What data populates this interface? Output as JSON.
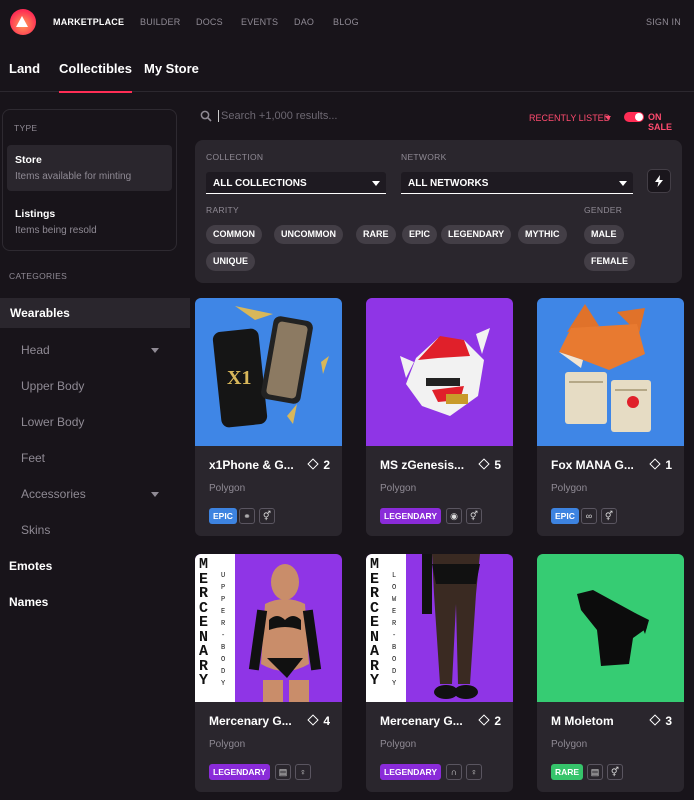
{
  "nav": {
    "items": [
      "MARKETPLACE",
      "BUILDER",
      "DOCS",
      "EVENTS",
      "DAO",
      "BLOG"
    ],
    "sign_in": "SIGN IN"
  },
  "tabs": [
    "Land",
    "Collectibles",
    "My Store"
  ],
  "sidebar": {
    "type_label": "TYPE",
    "types": [
      {
        "title": "Store",
        "subtitle": "Items available for minting"
      },
      {
        "title": "Listings",
        "subtitle": "Items being resold"
      }
    ],
    "categories_label": "CATEGORIES",
    "categories": [
      "Wearables",
      "Head",
      "Upper Body",
      "Lower Body",
      "Feet",
      "Accessories",
      "Skins",
      "Emotes",
      "Names"
    ]
  },
  "search": {
    "placeholder": "Search +1,000 results..."
  },
  "sort": {
    "label": "RECENTLY LISTED"
  },
  "on_sale": {
    "label": "ON SALE",
    "enabled": true
  },
  "filters": {
    "collection_label": "COLLECTION",
    "collection_value": "ALL COLLECTIONS",
    "network_label": "NETWORK",
    "network_value": "ALL NETWORKS",
    "rarity_label": "RARITY",
    "rarities": [
      "COMMON",
      "UNCOMMON",
      "RARE",
      "EPIC",
      "LEGENDARY",
      "MYTHIC",
      "UNIQUE"
    ],
    "gender_label": "GENDER",
    "genders": [
      "MALE",
      "FEMALE"
    ]
  },
  "cards": [
    {
      "name": "x1Phone & G...",
      "count": "2",
      "network": "Polygon",
      "rarity": "EPIC",
      "rarity_color": "#3d83e0",
      "bg": "#3f86e6"
    },
    {
      "name": "MS zGenesis...",
      "count": "5",
      "network": "Polygon",
      "rarity": "LEGENDARY",
      "rarity_color": "#8a2bd9",
      "bg": "#8f35e6"
    },
    {
      "name": "Fox MANA G...",
      "count": "1",
      "network": "Polygon",
      "rarity": "EPIC",
      "rarity_color": "#3d83e0",
      "bg": "#3f86e6"
    },
    {
      "name": "Mercenary G...",
      "count": "4",
      "network": "Polygon",
      "rarity": "LEGENDARY",
      "rarity_color": "#8a2bd9",
      "bg": "#8f35e6",
      "side_text": "MERCENARY",
      "side_sub": "UPPER-BODY"
    },
    {
      "name": "Mercenary G...",
      "count": "2",
      "network": "Polygon",
      "rarity": "LEGENDARY",
      "rarity_color": "#8a2bd9",
      "bg": "#8f35e6",
      "side_text": "MERCENARY",
      "side_sub": "LOWER-BODY"
    },
    {
      "name": "M Moletom",
      "count": "3",
      "network": "Polygon",
      "rarity": "RARE",
      "rarity_color": "#36c46b",
      "bg": "#36cc73"
    }
  ]
}
